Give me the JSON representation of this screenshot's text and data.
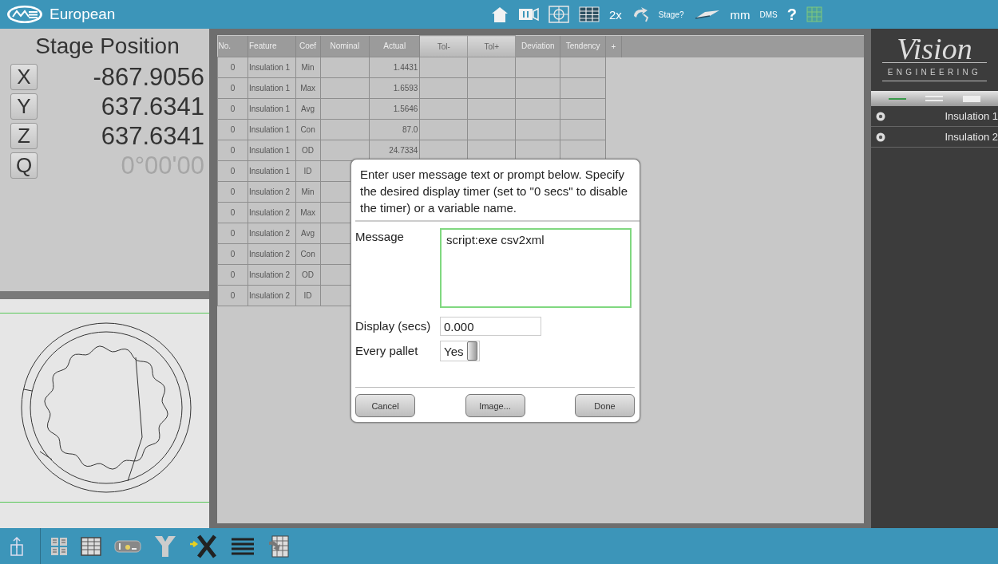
{
  "top_bar": {
    "title": "European",
    "zoom": "2x",
    "stage_prompt": "Stage?",
    "units": "mm",
    "angle_format": "DMS",
    "help": "?"
  },
  "stage_position": {
    "title": "Stage Position",
    "axes": [
      {
        "label": "X",
        "value": "-867.9056",
        "disabled": false
      },
      {
        "label": "Y",
        "value": "637.6341",
        "disabled": false
      },
      {
        "label": "Z",
        "value": "637.6341",
        "disabled": false
      },
      {
        "label": "Q",
        "value": "0°00'00",
        "disabled": true
      }
    ]
  },
  "table": {
    "columns": [
      {
        "label": "No.",
        "kind": "plain"
      },
      {
        "label": "Feature",
        "kind": "plain"
      },
      {
        "label": "Coef",
        "kind": "plain"
      },
      {
        "label": "Nominal",
        "kind": "plain"
      },
      {
        "label": "Actual",
        "kind": "plain"
      },
      {
        "label": "Tol-",
        "kind": "button"
      },
      {
        "label": "Tol+",
        "kind": "button"
      },
      {
        "label": "Deviation",
        "kind": "plain"
      },
      {
        "label": "Tendency",
        "kind": "plain"
      },
      {
        "label": "+",
        "kind": "plain"
      }
    ],
    "rows": [
      {
        "no": "0",
        "feature": "Insulation 1",
        "coef": "Min",
        "actual": "1.4431"
      },
      {
        "no": "0",
        "feature": "Insulation 1",
        "coef": "Max",
        "actual": "1.6593"
      },
      {
        "no": "0",
        "feature": "Insulation 1",
        "coef": "Avg",
        "actual": "1.5646"
      },
      {
        "no": "0",
        "feature": "Insulation 1",
        "coef": "Con",
        "actual": "87.0"
      },
      {
        "no": "0",
        "feature": "Insulation 1",
        "coef": "OD",
        "actual": "24.7334"
      },
      {
        "no": "0",
        "feature": "Insulation 1",
        "coef": "ID"
      },
      {
        "no": "0",
        "feature": "Insulation 2",
        "coef": "Min"
      },
      {
        "no": "0",
        "feature": "Insulation 2",
        "coef": "Max"
      },
      {
        "no": "0",
        "feature": "Insulation 2",
        "coef": "Avg"
      },
      {
        "no": "0",
        "feature": "Insulation 2",
        "coef": "Con"
      },
      {
        "no": "0",
        "feature": "Insulation 2",
        "coef": "OD"
      },
      {
        "no": "0",
        "feature": "Insulation 2",
        "coef": "ID"
      }
    ]
  },
  "dialog": {
    "prompt": "Enter user message text or prompt below. Specify the desired display timer (set to \"0 secs\" to disable the timer) or a variable name.",
    "message_label": "Message",
    "message_value": "script:exe csv2xml",
    "display_label": "Display (secs)",
    "display_value": "0.000",
    "every_pallet_label": "Every pallet",
    "every_pallet": {
      "text": "Yes",
      "on": true
    },
    "buttons": [
      "Cancel",
      "Image...",
      "Done"
    ]
  },
  "feature_panel": {
    "logo_name": "Vision",
    "logo_tagline": "ENGINEERING",
    "view_tabs": [
      {
        "kind": "single",
        "selected": true
      },
      {
        "kind": "double",
        "selected": false
      },
      {
        "kind": "block",
        "selected": false
      }
    ],
    "features": [
      {
        "label": "Insulation 1"
      },
      {
        "label": "Insulation 2"
      }
    ]
  }
}
